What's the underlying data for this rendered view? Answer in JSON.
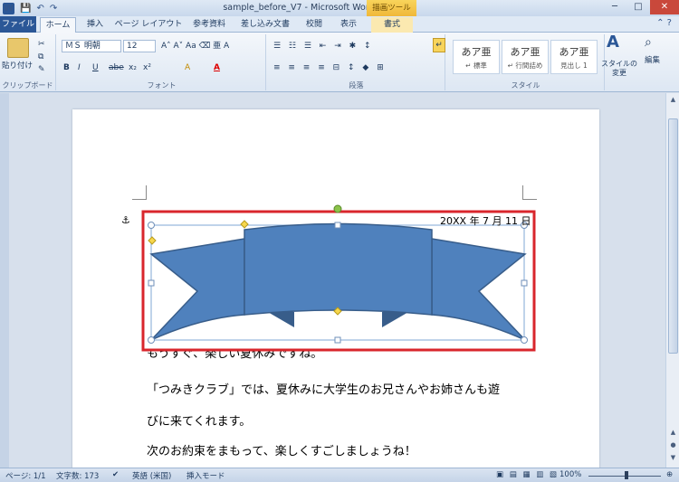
{
  "window": {
    "title": "sample_before_V7 - Microsoft Word",
    "context_tab_group": "描画ツール",
    "qat": {
      "logo": "W",
      "save": "💾",
      "undo": "↶",
      "redo": "↷"
    }
  },
  "tabs": [
    "ファイル",
    "ホーム",
    "挿入",
    "ページ レイアウト",
    "参考資料",
    "差し込み文書",
    "校閲",
    "表示",
    "書式"
  ],
  "ribbon": {
    "clipboard": {
      "paste_label": "貼り付け",
      "group_label": "クリップボード"
    },
    "font": {
      "font_name": "ＭＳ 明朝",
      "font_size": "12",
      "group_label": "フォント",
      "buttons": [
        "B",
        "I",
        "U",
        "abe",
        "x₂",
        "x²",
        "A",
        "A"
      ]
    },
    "paragraph": {
      "group_label": "段落"
    },
    "styles": {
      "group_label": "スタイル",
      "items": [
        {
          "sample": "あア亜",
          "name": "↵ 標準"
        },
        {
          "sample": "あア亜",
          "name": "↵ 行間詰め"
        },
        {
          "sample": "あア亜",
          "name": "見出し 1"
        }
      ],
      "change_label": "スタイルの変更",
      "edit_label": "編集"
    }
  },
  "document": {
    "date_line": "20XX 年 7 月 11 日",
    "lines": [
      "もうすぐ、楽しい夏休みですね。",
      "「つみきクラブ」では、夏休みに大学生のお兄さんやお姉さんも遊",
      "びに来てくれます。",
      "次のお約束をまもって、楽しくすごしましょうね！"
    ],
    "anchor_icon": "⚓",
    "shape": {
      "type": "ribbon-banner",
      "fill": "#4f81bd",
      "stroke": "#385d8a",
      "selection_color": "#d9262c"
    }
  },
  "statusbar": {
    "page": "ページ: 1/1",
    "word_count": "文字数: 173",
    "language": "英語 (米国)",
    "mode": "挿入モード",
    "zoom": "100%"
  }
}
